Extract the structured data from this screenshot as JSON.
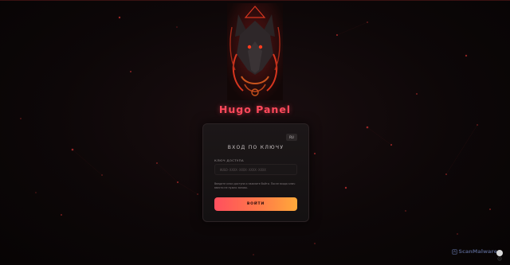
{
  "app": {
    "title": "Hugo Panel"
  },
  "login": {
    "language_label": "RU",
    "heading": "ВХОД ПО КЛЮЧУ",
    "key_label": "КЛЮЧ ДОСТУПА",
    "key_placeholder": "HUGO-XXXX-XXXX-XXXX-XXXX",
    "hint": "Введите ключ доступа и нажмите Войти. После входа ключ ввести не нужно заново.",
    "submit_label": "ВОЙТИ"
  },
  "watermark": {
    "text": "ScanMalware"
  },
  "colors": {
    "accent": "#ff4a5c",
    "button_gradient_start": "#ff4f5e",
    "button_gradient_end": "#ffa93a",
    "background": "#0d0708",
    "card": "#181415"
  },
  "icons": [
    "wolf-logo",
    "gear-icon",
    "scanmalware-icon"
  ]
}
